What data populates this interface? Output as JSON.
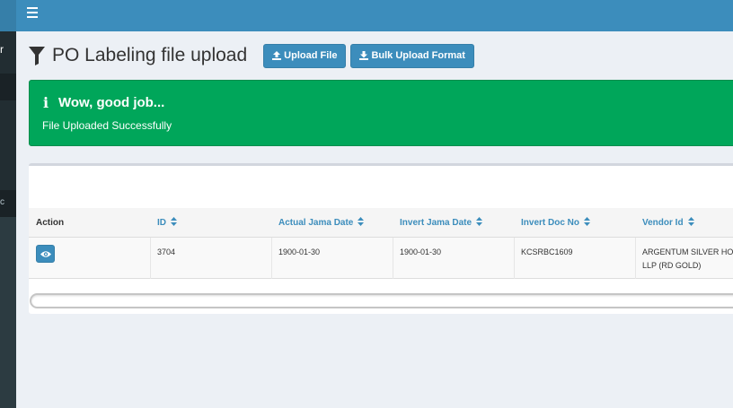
{
  "sidebar": {
    "user_fragment": "r",
    "header_fragment": "c"
  },
  "header": {
    "title": "PO Labeling file upload",
    "upload_button": "Upload File",
    "bulk_button": "Bulk Upload Format"
  },
  "alert": {
    "title": "Wow, good job...",
    "message": "File Uploaded Successfully",
    "color": "#00a65a"
  },
  "table": {
    "columns": [
      "Action",
      "ID",
      "Actual Jama Date",
      "Invert Jama Date",
      "Invert Doc No",
      "Vendor Id"
    ],
    "rows": [
      {
        "id": "3704",
        "actual_jama_date": "1900-01-30",
        "invert_jama_date": "1900-01-30",
        "invert_doc_no": "KCSRBC1609",
        "vendor_id_line1": "ARGENTUM SILVER HO",
        "vendor_id_line2": "LLP (RD GOLD)"
      }
    ]
  },
  "colors": {
    "primary": "#3c8dbc",
    "topbar": "#3c8dbc",
    "sidebar": "#222d32",
    "success": "#00a65a"
  },
  "icons": {
    "menu": "bars-icon",
    "title": "funnel-icon",
    "upload": "upload-icon",
    "download": "download-icon",
    "alert": "info-icon",
    "view": "eye-icon",
    "sort": "sort-icon"
  }
}
